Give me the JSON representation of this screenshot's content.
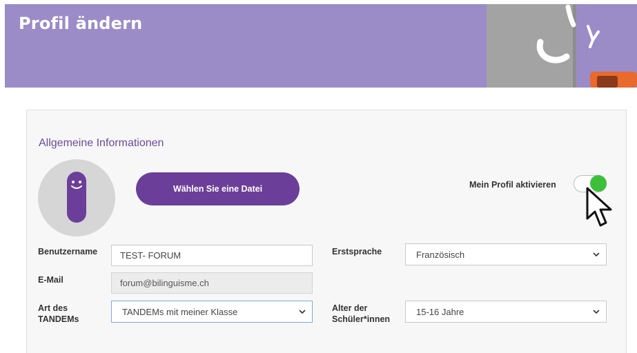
{
  "header": {
    "title": "Profil ändern"
  },
  "colors": {
    "banner": "#9b8cc8",
    "accent_purple": "#6b3f99",
    "toggle_on": "#3cc03c"
  },
  "section": {
    "title": "Allgemeine Informationen"
  },
  "avatar": {
    "icon": "smiley-character-icon"
  },
  "file_button": {
    "label": "Wählen Sie eine Datei"
  },
  "profile_toggle": {
    "label": "Mein Profil aktivieren",
    "state": "on"
  },
  "form": {
    "username": {
      "label": "Benutzername",
      "value": "TEST- FORUM"
    },
    "email": {
      "label": "E-Mail",
      "value": "forum@bilinguisme.ch"
    },
    "tandem_type": {
      "label_line1": "Art des",
      "label_line2": "TANDEMs",
      "selected": "TANDEMs mit meiner Klasse"
    },
    "first_language": {
      "label": "Erstsprache",
      "selected": "Französisch"
    },
    "student_age": {
      "label_line1": "Alter der",
      "label_line2": "Schüler*innen",
      "selected": "15-16 Jahre"
    }
  }
}
